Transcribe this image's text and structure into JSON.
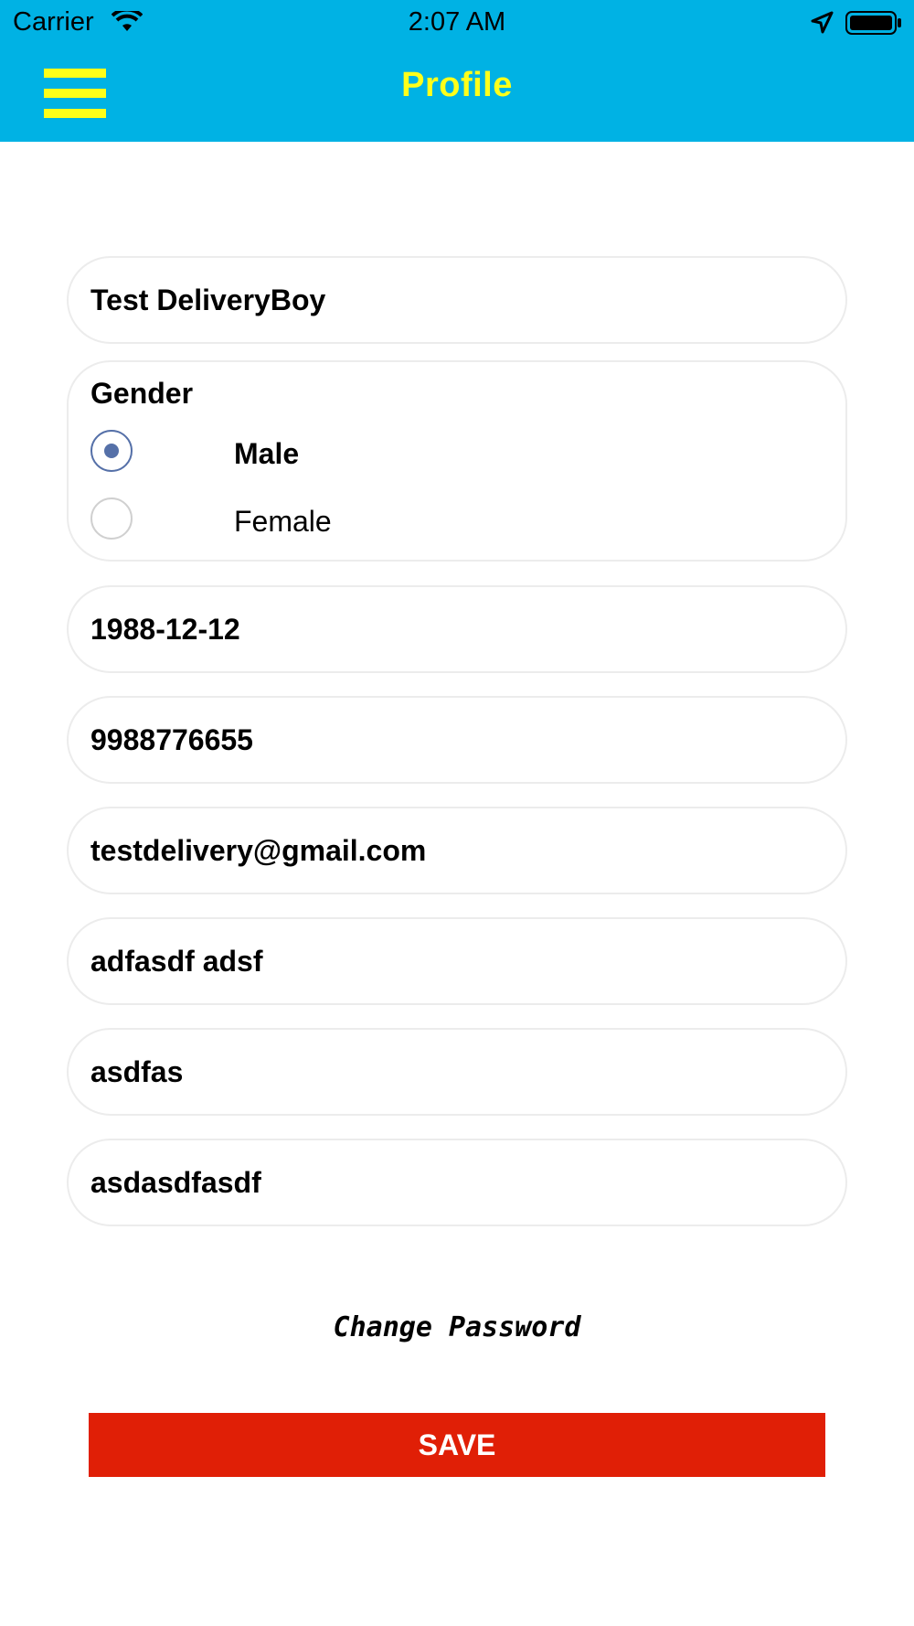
{
  "status_bar": {
    "carrier": "Carrier",
    "time": "2:07 AM"
  },
  "header": {
    "title": "Profile",
    "accent_color": "#00b2e4",
    "title_color": "#ffff1a"
  },
  "form": {
    "name": "Test DeliveryBoy",
    "gender": {
      "label": "Gender",
      "options": [
        {
          "label": "Male",
          "selected": true
        },
        {
          "label": "Female",
          "selected": false
        }
      ]
    },
    "dob": "1988-12-12",
    "phone": "9988776655",
    "email": "testdelivery@gmail.com",
    "address_line1": "adfasdf adsf",
    "address_line2": "asdfas",
    "address_line3": "asdasdfasdf"
  },
  "actions": {
    "change_password": "Change Password",
    "save": "SAVE",
    "save_color": "#e01f06"
  }
}
